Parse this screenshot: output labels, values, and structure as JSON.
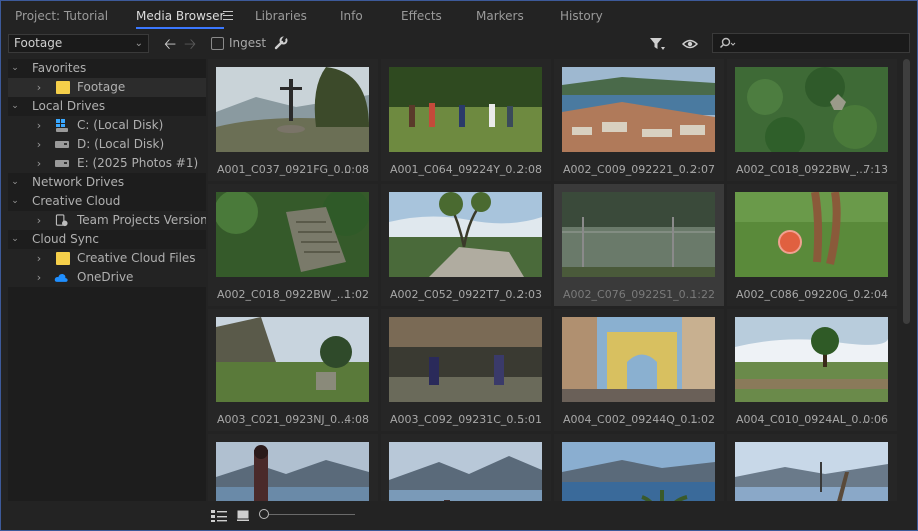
{
  "tabs": [
    {
      "label": "Project: Tutorial",
      "active": false
    },
    {
      "label": "Media Browser",
      "active": true
    },
    {
      "label": "Libraries",
      "active": false
    },
    {
      "label": "Info",
      "active": false
    },
    {
      "label": "Effects",
      "active": false
    },
    {
      "label": "Markers",
      "active": false
    },
    {
      "label": "History",
      "active": false
    }
  ],
  "toolbar": {
    "location_value": "Footage",
    "ingest_label": "Ingest",
    "ingest_checked": false,
    "search_value": ""
  },
  "tree": {
    "items": [
      {
        "label": "Favorites",
        "type": "section",
        "expanded": true
      },
      {
        "label": "Footage",
        "type": "folder",
        "selected": true
      },
      {
        "label": "Local Drives",
        "type": "section",
        "expanded": true
      },
      {
        "label": "C: (Local Disk)",
        "type": "drive-win"
      },
      {
        "label": "D: (Local Disk)",
        "type": "drive"
      },
      {
        "label": "E: (2025 Photos #1)",
        "type": "drive"
      },
      {
        "label": "Network Drives",
        "type": "section",
        "expanded": true
      },
      {
        "label": "Creative Cloud",
        "type": "section",
        "expanded": true
      },
      {
        "label": "Team Projects Versions",
        "type": "team"
      },
      {
        "label": "Cloud Sync",
        "type": "section",
        "expanded": true
      },
      {
        "label": "Creative Cloud Files",
        "type": "folder"
      },
      {
        "label": "OneDrive",
        "type": "cloud"
      }
    ]
  },
  "clips": [
    {
      "name": "A001_C037_0921FG_0...",
      "duration": "0:08",
      "scene": "hill-cross",
      "selected": false
    },
    {
      "name": "A001_C064_09224Y_0...",
      "duration": "2:08",
      "scene": "soccer-kids",
      "selected": false
    },
    {
      "name": "A002_C009_092221_0...",
      "duration": "2:07",
      "scene": "town-lake",
      "selected": false
    },
    {
      "name": "A002_C018_0922BW_...",
      "duration": "7:13",
      "scene": "jungle-aerial",
      "selected": false
    },
    {
      "name": "A002_C018_0922BW_...",
      "duration": "1:02",
      "scene": "ruins-forest",
      "selected": false
    },
    {
      "name": "A002_C052_0922T7_0...",
      "duration": "2:03",
      "scene": "tree-rock",
      "selected": false
    },
    {
      "name": "A002_C076_0922S1_0...",
      "duration": "1:22",
      "scene": "soccer-field",
      "selected": true
    },
    {
      "name": "A002_C086_09220G_0...",
      "duration": "2:04",
      "scene": "ball-kick",
      "selected": false
    },
    {
      "name": "A003_C021_0923NJ_0...",
      "duration": "4:08",
      "scene": "hut-ruins",
      "selected": false
    },
    {
      "name": "A003_C092_09231C_0...",
      "duration": "5:01",
      "scene": "village-kids",
      "selected": false
    },
    {
      "name": "A004_C002_09244Q_0...",
      "duration": "1:02",
      "scene": "arch-street",
      "selected": false
    },
    {
      "name": "A004_C010_0924AL_0...",
      "duration": "0:06",
      "scene": "lone-tree",
      "selected": false
    },
    {
      "name": "",
      "duration": "",
      "scene": "lake-girl",
      "selected": false
    },
    {
      "name": "",
      "duration": "",
      "scene": "lake-volcano",
      "selected": false
    },
    {
      "name": "",
      "duration": "",
      "scene": "lake-palm",
      "selected": false
    },
    {
      "name": "",
      "duration": "",
      "scene": "lake-dock",
      "selected": false
    }
  ],
  "view": {
    "mode": "icon"
  }
}
